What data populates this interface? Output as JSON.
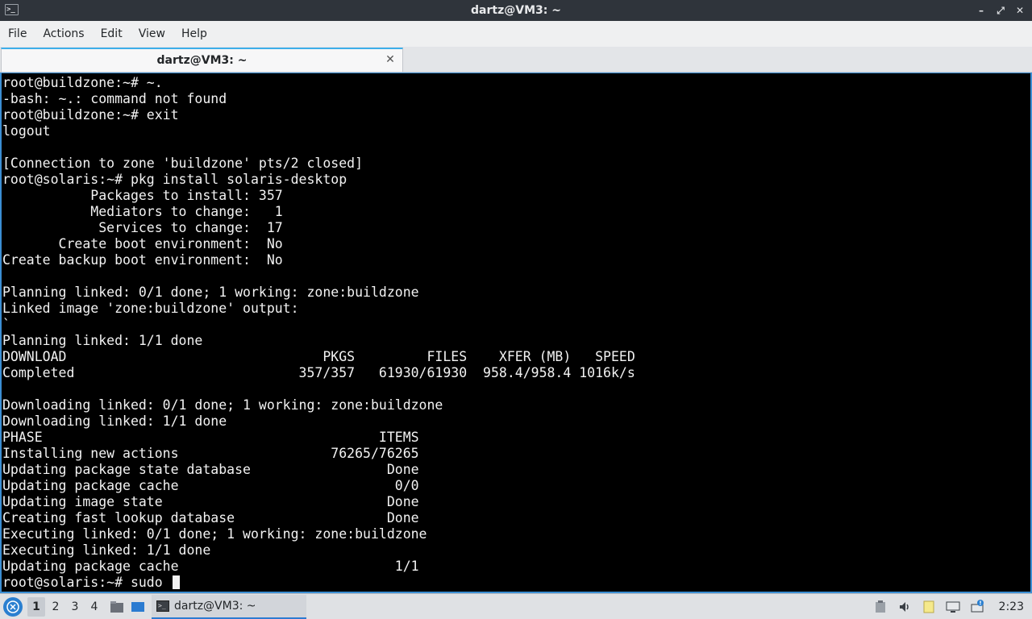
{
  "window": {
    "title": "dartz@VM3: ~",
    "buttons": [
      "–",
      "⤢",
      "✕"
    ]
  },
  "menu": [
    "File",
    "Actions",
    "Edit",
    "View",
    "Help"
  ],
  "tab": {
    "label": "dartz@VM3: ~",
    "close": "✕"
  },
  "terminal": {
    "lines": [
      "root@buildzone:~# ~.",
      "-bash: ~.: command not found",
      "root@buildzone:~# exit",
      "logout",
      "",
      "[Connection to zone 'buildzone' pts/2 closed]",
      "root@solaris:~# pkg install solaris-desktop",
      "           Packages to install: 357",
      "           Mediators to change:   1",
      "            Services to change:  17",
      "       Create boot environment:  No",
      "Create backup boot environment:  No",
      "",
      "Planning linked: 0/1 done; 1 working: zone:buildzone",
      "Linked image 'zone:buildzone' output:",
      "`",
      "Planning linked: 1/1 done",
      "DOWNLOAD                                PKGS         FILES    XFER (MB)   SPEED",
      "Completed                            357/357   61930/61930  958.4/958.4 1016k/s",
      "",
      "Downloading linked: 0/1 done; 1 working: zone:buildzone",
      "Downloading linked: 1/1 done",
      "PHASE                                          ITEMS",
      "Installing new actions                   76265/76265",
      "Updating package state database                 Done",
      "Updating package cache                           0/0",
      "Updating image state                            Done",
      "Creating fast lookup database                   Done",
      "Executing linked: 0/1 done; 1 working: zone:buildzone",
      "Executing linked: 1/1 done",
      "Updating package cache                           1/1"
    ],
    "prompt": "root@solaris:~# sudo "
  },
  "taskbar": {
    "workspaces": [
      "1",
      "2",
      "3",
      "4"
    ],
    "active_workspace": "1",
    "task_label": "dartz@VM3: ~",
    "clock": "2:23"
  },
  "colors": {
    "terminal_bg": "#000000",
    "terminal_fg": "#f2f2f2",
    "accent": "#3b8ed3"
  }
}
